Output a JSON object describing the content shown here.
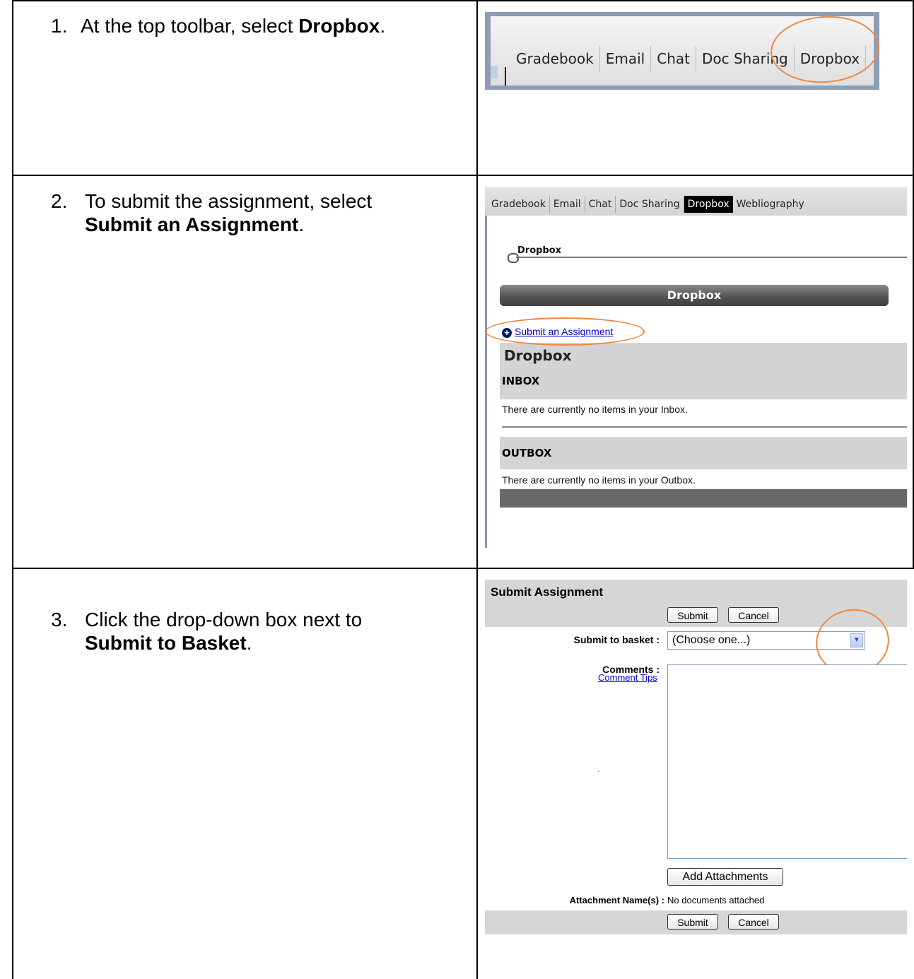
{
  "steps": [
    {
      "number": "1.",
      "prefix": " At the top toolbar, select ",
      "bold": "Dropbox",
      "suffix": "."
    },
    {
      "number": "2.",
      "line1": "To submit the assignment, select",
      "bold": "Submit an Assignment",
      "suffix": "."
    },
    {
      "number": "3.",
      "line1": "Click the drop-down box next to",
      "bold": "Submit to Basket",
      "suffix": "."
    }
  ],
  "shot1": {
    "tabs": [
      "Gradebook",
      "Email",
      "Chat",
      "Doc Sharing",
      "Dropbox"
    ]
  },
  "shot2": {
    "tabs": [
      "Gradebook",
      "Email",
      "Chat",
      "Doc Sharing",
      "Dropbox",
      "Webliography"
    ],
    "active_tab": "Dropbox",
    "breadcrumb": "Dropbox",
    "banner": "Dropbox",
    "submit_link": "Submit an Assignment",
    "section_title": "Dropbox",
    "inbox_heading": "INBOX",
    "inbox_text": "There are currently no items in your Inbox.",
    "outbox_heading": "OUTBOX",
    "outbox_text": "There are currently no items in your Outbox."
  },
  "shot3": {
    "title": "Submit Assignment",
    "submit_label": "Submit",
    "cancel_label": "Cancel",
    "basket_label": "Submit to basket :",
    "basket_value": "(Choose one...)",
    "comments_label": "Comments :",
    "comment_tips": "Comment Tips",
    "add_attachments": "Add Attachments",
    "attachment_label": "Attachment Name(s) :",
    "attachment_value": "No documents attached"
  },
  "colors": {
    "highlight": "#f0883e",
    "active_tab_bg": "#000000",
    "link": "#0000cc",
    "banner_bg": "#555555"
  }
}
